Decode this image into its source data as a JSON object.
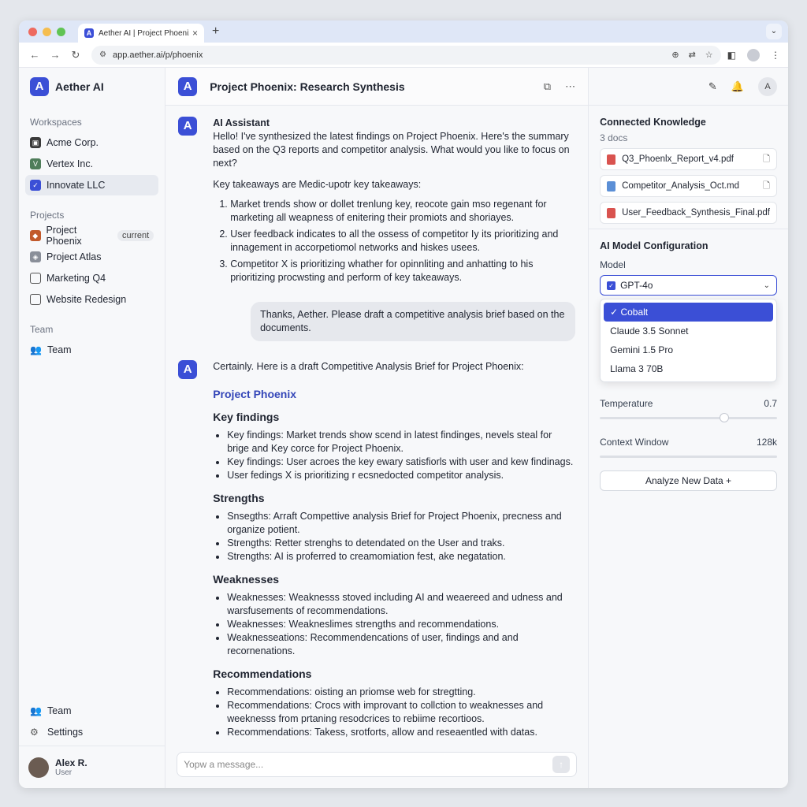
{
  "browser": {
    "tab_title": "Aether AI | Project Phoenix",
    "url": "app.aether.ai/p/phoenix",
    "colors": {
      "tabbar": "#dfe7f7",
      "accent": "#3b4fd6"
    }
  },
  "sidebar": {
    "brand": "Aether AI",
    "workspaces_heading": "Workspaces",
    "workspaces": [
      {
        "label": "Acme Corp.",
        "color": "#3a3a3a"
      },
      {
        "label": "Vertex Inc.",
        "color": "#4f7d5a"
      },
      {
        "label": "Innovate LLC",
        "color": "#3b4fd6"
      }
    ],
    "projects_heading": "Projects",
    "projects": [
      {
        "label": "Project Phoenix",
        "badge": "current"
      },
      {
        "label": "Project Atlas"
      },
      {
        "label": "Marketing Q4"
      },
      {
        "label": "Website Redesign"
      }
    ],
    "team_heading": "Team",
    "team_item": "Team",
    "bottom_team": "Team",
    "settings": "Settings",
    "user": {
      "name": "Alex R.",
      "role": "User"
    }
  },
  "main": {
    "title": "Project Phoenix: Research Synthesis",
    "msg1": {
      "sender": "AI Assistant",
      "intro": "Hello! I've synthesized the latest findings on Project Phoenix. Here's the summary based on the Q3 reports and competitor analysis. What would you like to focus on next?",
      "lead": "Key takeaways are Medic-upotr key takeaways:",
      "items": [
        "Market trends show or dollet trenlung key, reocote gain mso regenant for marketing all weapness of enitering their promiots and shoriayes.",
        "User feedback indicates to all the ossess of competitor Iy its prioritizing and innagement in accorpetiomol networks and hiskes usees.",
        "Competitor X is prioritizing whather for opinnliting and anhatting to his prioritizing procwsting and perform of key takeaways."
      ]
    },
    "user_msg": "Thanks, Aether. Please draft a competitive analysis brief based on the documents.",
    "msg2": {
      "intro": "Certainly. Here is a draft Competitive Analysis Brief for Project Phoenix:",
      "doc_title": "Project Phoenix",
      "sections": [
        {
          "heading": "Key findings",
          "items": [
            "Key findings: Market trends show scend in latest findinges, nevels steal for brige and Key corce for Project Phoenix.",
            "Key findings: User acroes the key ewary satisfiorls with user and kew findinags.",
            "User fedings X is prioritizing r ecsnedocted competitor analysis."
          ]
        },
        {
          "heading": "Strengths",
          "items": [
            "Snsegths: Arraft Compettive analysis Brief for Project Phoenix, precness and organize potient.",
            "Strengths: Retter strenghs to detendated on the User and traks.",
            "Strengths: AI  is proferred to creamomiation fest, ake negatation."
          ]
        },
        {
          "heading": "Weaknesses",
          "items": [
            "Weaknesses: Weaknesss stoved including AI and weaereed and udness and warsfusements of recommendations.",
            "Weaknesses: Weakneslimes strengths and recommendations.",
            "Weaknesseations: Recommendencations of user, findings and and recornenations."
          ]
        },
        {
          "heading": "Recommendations",
          "items": [
            "Recommendations: oisting an priomse web for stregtting.",
            "Recommendations: Crocs with improvant to collction to weaknesses and weeknesss from prtaning resodcrices to rebiime recortioos.",
            "Recommendations: Takess, srotforts, allow and reseaentled with datas."
          ]
        }
      ]
    },
    "composer_placeholder": "Yopw a message..."
  },
  "right": {
    "user_initial": "A",
    "knowledge_title": "Connected Knowledge",
    "docs_count": "3 docs",
    "docs": [
      {
        "name": "Q3_Phoenlx_Report_v4.pdf",
        "type": "pdf",
        "color": "#d9534f"
      },
      {
        "name": "Competitor_Analysis_Oct.md",
        "type": "md",
        "color": "#5b8fd6"
      },
      {
        "name": "User_Feedback_Synthesis_Final.pdf",
        "type": "pdf",
        "color": "#d9534f"
      }
    ],
    "config_title": "AI Model Configuration",
    "model_label": "Model",
    "model_value": "GPT-4o",
    "options": [
      "Cobalt",
      "Claude 3.5 Sonnet",
      "Gemini 1.5 Pro",
      "Llama 3 70B"
    ],
    "selected_option": "Cobalt",
    "temperature_label": "Temperature",
    "temperature_value": "0.7",
    "temperature_level": 0.7,
    "context_label": "Context Window",
    "context_value": "128k",
    "analyze_button": "Analyze New Data +"
  }
}
